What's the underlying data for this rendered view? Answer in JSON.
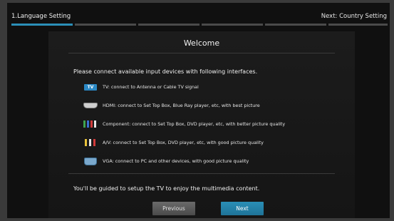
{
  "header": {
    "current_step": "1.Language Setting",
    "next_step": "Next: Country Setting"
  },
  "dialog": {
    "title": "Welcome",
    "instruction": "Please connect available input devices with following interfaces.",
    "interfaces": [
      {
        "icon": "tv-icon",
        "icon_label": "TV",
        "text": "TV: connect to Antenna or Cable TV signal"
      },
      {
        "icon": "hdmi-icon",
        "text": "HDMI: connect to Set Top Box, Blue Ray player, etc, with best picture"
      },
      {
        "icon": "component-icon",
        "text": "Component: connect to Set Top Box, DVD player, etc, with better picture quality"
      },
      {
        "icon": "av-icon",
        "text": "A/V: connect to Set Top Box, DVD player, etc, with good picture quality"
      },
      {
        "icon": "vga-icon",
        "text": "VGA: connect to PC and other devices, with good picture quality"
      }
    ],
    "footer": "You'll be guided to setup the TV to enjoy the multimedia content.",
    "buttons": {
      "previous": "Previous",
      "next": "Next"
    }
  },
  "colors": {
    "accent": "#2b8fb8",
    "background": "#101010"
  }
}
